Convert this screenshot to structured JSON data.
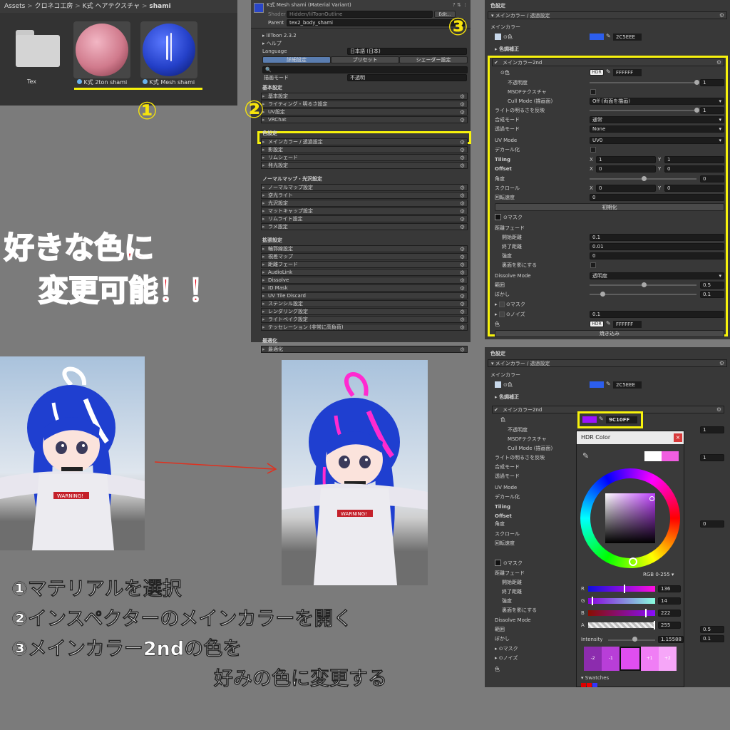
{
  "project_panel": {
    "breadcrumb": [
      "Assets",
      "クロネコ工房",
      "K式 ヘアテクスチャ",
      "shami"
    ],
    "items": [
      {
        "label": "Tex",
        "kind": "folder"
      },
      {
        "label": "K式 2ton shami",
        "kind": "material",
        "color": "#d88a9a"
      },
      {
        "label": "K式 Mesh shami",
        "kind": "material",
        "color": "#2a46c8"
      }
    ]
  },
  "inspector": {
    "title": "K式 Mesh shami (Material Variant)",
    "shader_label": "Shader",
    "shader_value": "Hidden/lilToonOutline",
    "edit_label": "Edit...",
    "parent_label": "Parent",
    "parent_value": "tex2_body_shami",
    "version": "lilToon 2.3.2",
    "help": "ヘルプ",
    "language_label": "Language",
    "language_value": "日本語 (日本)",
    "tabs": [
      "詳細設定",
      "プリセット",
      "シェーダー設定"
    ],
    "render_mode_label": "描画モード",
    "render_mode_value": "不透明",
    "sections": [
      {
        "heading": "基本設定",
        "items": [
          "基本設定",
          "ライティング・明るさ設定",
          "UV設定",
          "VRChat"
        ]
      },
      {
        "heading": "色設定",
        "items": [
          "メインカラー / 透過設定",
          "影設定",
          "リムシェード",
          "発光設定"
        ]
      },
      {
        "heading": "ノーマルマップ・光沢設定",
        "items": [
          "ノーマルマップ設定",
          "逆光ライト",
          "光沢設定",
          "マットキャップ設定",
          "リムライト設定",
          "ラメ設定"
        ]
      },
      {
        "heading": "拡張設定",
        "items": [
          "輪郭線設定",
          "視差マップ",
          "距離フェード",
          "AudioLink",
          "Dissolve",
          "ID Mask",
          "UV Tile Discard",
          "ステンシル設定",
          "レンダリング設定",
          "ライトベイク設定",
          "テッセレーション (非常に高負荷)"
        ]
      },
      {
        "heading": "最適化",
        "items": [
          "最適化"
        ]
      }
    ]
  },
  "color_panel": {
    "title": "色設定",
    "section": "メインカラー / 透過設定",
    "main_color_label": "メインカラー",
    "color_label": "色",
    "color_hex": "2C5EEE",
    "color_value": "#2C5EEE",
    "hdr": "HDR",
    "tone_label": "色調補正",
    "second_label": "メインカラー2nd",
    "second_color_hex": "FFFFFF",
    "rows": [
      {
        "label": "不透明度",
        "value": "1"
      },
      {
        "label": "MSDFテクスチャ",
        "value": ""
      },
      {
        "label": "Cull Mode (描画面)",
        "value": "Off (両面を描画)"
      },
      {
        "label": "ライトの明るさを反映",
        "value": "1"
      },
      {
        "label": "合成モード",
        "value": "通常"
      },
      {
        "label": "透過モード",
        "value": "None"
      },
      {
        "label": "UV Mode",
        "value": "UV0"
      },
      {
        "label": "デカール化",
        "value": ""
      }
    ],
    "tiling_label": "Tiling",
    "tiling": [
      "1",
      "1"
    ],
    "offset_label": "Offset",
    "offset": [
      "0",
      "0"
    ],
    "angle_label": "角度",
    "angle_value": "0",
    "scroll_label": "スクロール",
    "scroll": [
      "0",
      "0"
    ],
    "rotate_label": "回転速度",
    "rotate_value": "0",
    "reset_btn": "初期化",
    "mask_label": "マスク",
    "fade_label": "距離フェード",
    "fade_rows": [
      {
        "label": "開始距離",
        "value": "0.1"
      },
      {
        "label": "終了距離",
        "value": "0.01"
      },
      {
        "label": "強度",
        "value": "0"
      },
      {
        "label": "裏面を影にする",
        "value": ""
      }
    ],
    "dissolve_label": "Dissolve Mode",
    "dissolve_value": "透明度",
    "range_label": "範囲",
    "range_value": "0.5",
    "blur_label": "ぼかし",
    "blur_value": "0.1",
    "mask2_label": "マスク",
    "noise_label": "ノイズ",
    "noise_value": "0.1",
    "color2_label": "色",
    "color2_hex": "FFFFFF",
    "bake_btn": "焼き込み"
  },
  "color_panel_b": {
    "title": "色設定",
    "section": "メインカラー / 透過設定",
    "main_color_label": "メインカラー",
    "color_label": "色",
    "color_hex": "2C5EEE",
    "tone_label": "色調補正",
    "second_label": "メインカラー2nd",
    "second_color_hex": "9C10FF",
    "second_color_value": "#9C10FF",
    "rows": [
      "色",
      "不透明度",
      "MSDFテクスチャ",
      "Cull Mode (描画面)",
      "ライトの明るさを反映",
      "合成モード",
      "透過モード",
      "UV Mode",
      "デカール化",
      "Tiling",
      "Offset",
      "角度",
      "スクロール",
      "回転速度"
    ],
    "angle_value": "0",
    "opacity_value": "1",
    "light_value": "1",
    "mask_label": "マスク",
    "fade_label": "距離フェード",
    "fade_rows": [
      "開始距離",
      "終了距離",
      "強度",
      "裏面を影にする"
    ],
    "dissolve_label": "Dissolve Mode",
    "range_label": "範囲",
    "range_value": "0.5",
    "blur_label": "ぼかし",
    "blur_value": "0.1",
    "mask2_label": "マスク",
    "noise_label": "ノイズ",
    "color2_label": "色"
  },
  "hdr_picker": {
    "title": "HDR Color",
    "mode": "RGB 0-255",
    "channels": [
      {
        "name": "R",
        "value": "136"
      },
      {
        "name": "G",
        "value": "14"
      },
      {
        "name": "B",
        "value": "222"
      },
      {
        "name": "A",
        "value": "255"
      }
    ],
    "intensity_label": "Intensity",
    "intensity_value": "1.15588",
    "steps": [
      "-2",
      "-1",
      "",
      "+1",
      "+2"
    ],
    "swatches_label": "Swatches"
  },
  "callouts": {
    "num1": "①",
    "num2": "②",
    "num3": "③",
    "headline_line1": "好きな色に",
    "headline_line2": "変更可能！！",
    "step1": "①マテリアルを選択",
    "step2": "②インスペクターのメインカラーを開く",
    "step3": "③メインカラー2ndの色を",
    "step3b": "好みの色に変更する"
  },
  "colors": {
    "hair_before": "#1f3fd0",
    "hair_accent_before": "#ffffff",
    "hair_accent_after": "#ff2ad0",
    "yellow": "#f7f20c"
  }
}
